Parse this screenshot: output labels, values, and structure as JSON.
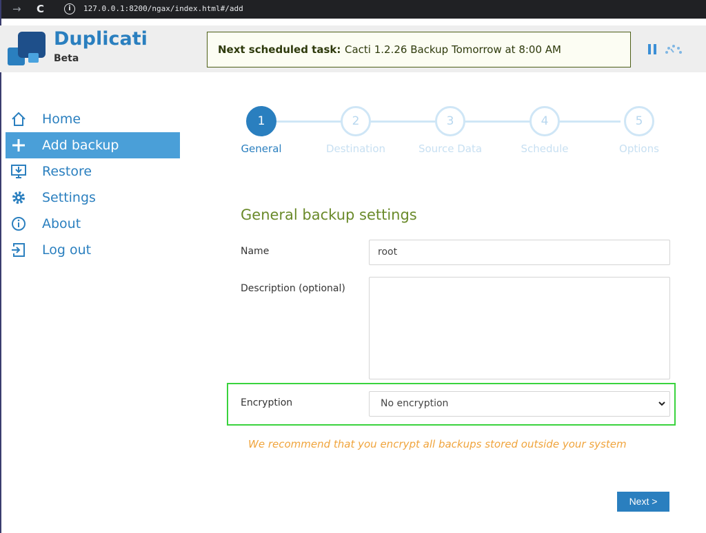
{
  "browser": {
    "url": "127.0.0.1:8200/ngax/index.html#/add"
  },
  "header": {
    "app_name": "Duplicati",
    "edition": "Beta",
    "schedule_label": "Next scheduled task:",
    "schedule_text": "Cacti 1.2.26 Backup Tomorrow at 8:00 AM"
  },
  "sidebar": {
    "items": [
      {
        "label": "Home",
        "icon": "home-icon",
        "active": false
      },
      {
        "label": "Add backup",
        "icon": "plus-icon",
        "active": true
      },
      {
        "label": "Restore",
        "icon": "restore-icon",
        "active": false
      },
      {
        "label": "Settings",
        "icon": "gear-icon",
        "active": false
      },
      {
        "label": "About",
        "icon": "info-icon",
        "active": false
      },
      {
        "label": "Log out",
        "icon": "logout-icon",
        "active": false
      }
    ]
  },
  "steps": [
    {
      "number": "1",
      "label": "General",
      "active": true
    },
    {
      "number": "2",
      "label": "Destination",
      "active": false
    },
    {
      "number": "3",
      "label": "Source Data",
      "active": false
    },
    {
      "number": "4",
      "label": "Schedule",
      "active": false
    },
    {
      "number": "5",
      "label": "Options",
      "active": false
    }
  ],
  "form": {
    "title": "General backup settings",
    "name_label": "Name",
    "name_value": "root",
    "description_label": "Description (optional)",
    "description_value": "",
    "encryption_label": "Encryption",
    "encryption_value": "No encryption",
    "warning": "We recommend that you encrypt all backups stored outside your system",
    "next_label": "Next >"
  },
  "colors": {
    "accent": "#2a7fbf",
    "section_title": "#6a8a2a",
    "warning": "#f0a43c",
    "highlight": "#39d33d"
  }
}
